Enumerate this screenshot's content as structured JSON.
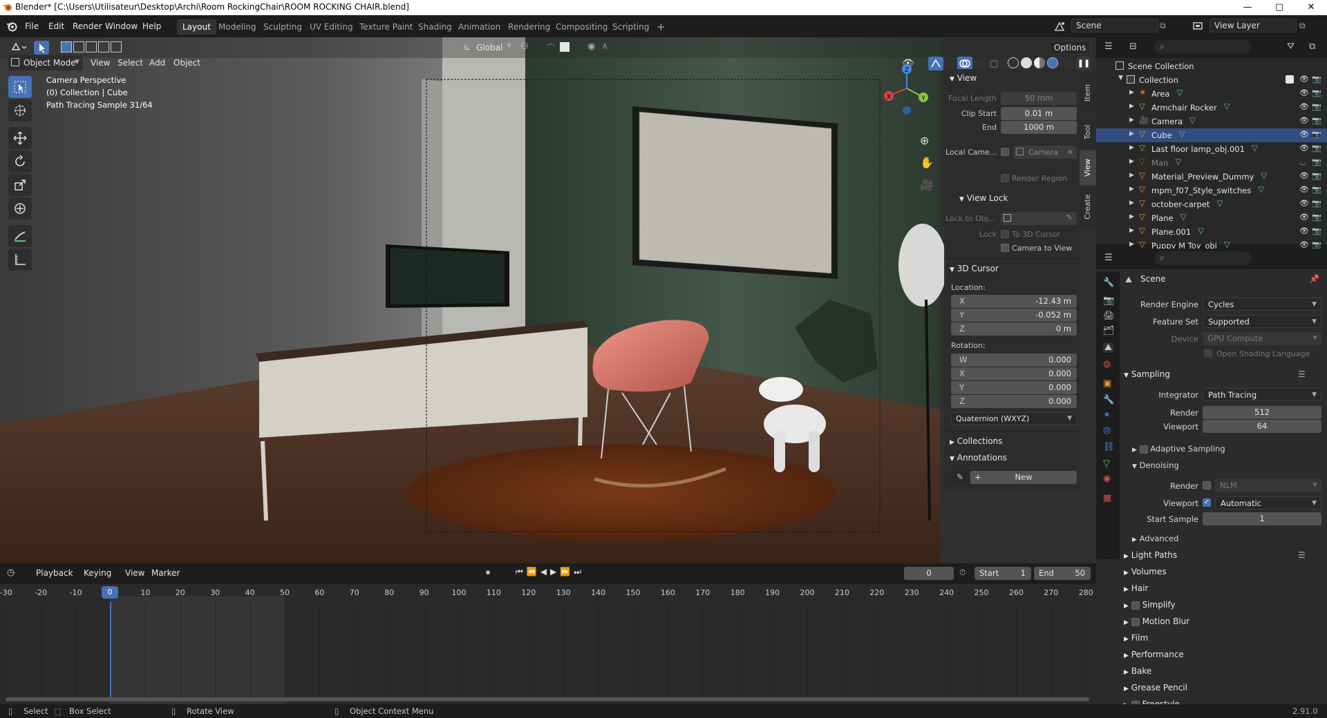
{
  "titlebar": {
    "title": "Blender* [C:\\Users\\Utilisateur\\Desktop\\Archi\\Room RockingChair\\ROOM ROCKING CHAIR.blend]",
    "minimize": "—",
    "maximize": "▢",
    "close": "✕"
  },
  "menubar": {
    "items": [
      "File",
      "Edit",
      "Render",
      "Window",
      "Help"
    ]
  },
  "workspaces": {
    "tabs": [
      "Layout",
      "Modeling",
      "Sculpting",
      "UV Editing",
      "Texture Paint",
      "Shading",
      "Animation",
      "Rendering",
      "Compositing",
      "Scripting"
    ],
    "active": "Layout",
    "add": "+"
  },
  "scene_selector": {
    "label": "Scene"
  },
  "viewlayer_selector": {
    "label": "View Layer"
  },
  "viewport_header": {
    "mode": "Object Mode",
    "menus": [
      "View",
      "Select",
      "Add",
      "Object"
    ],
    "transform_orientation": "Global",
    "options": "Options"
  },
  "viewport_overlay": {
    "line1": "Camera Perspective",
    "line2": "(0) Collection | Cube",
    "line3": "Path Tracing Sample 31/64"
  },
  "npanel": {
    "tabs": [
      "Item",
      "Tool",
      "View",
      "Create"
    ],
    "active_tab": "View",
    "view_section": "View",
    "focal_length_label": "Focal Length",
    "focal_length": "50 mm",
    "clip_start_label": "Clip Start",
    "clip_start": "0.01 m",
    "end_label": "End",
    "clip_end": "1000 m",
    "local_camera_label": "Local Came...",
    "local_camera_value": "Camera",
    "render_region": "Render Region",
    "view_lock_section": "View Lock",
    "lock_to_obj_label": "Lock to Obj...",
    "lock_label": "Lock",
    "to_3d_cursor": "To 3D Cursor",
    "camera_to_view": "Camera to View",
    "cursor_section": "3D Cursor",
    "location_label": "Location:",
    "loc": [
      {
        "k": "X",
        "v": "-12.43 m"
      },
      {
        "k": "Y",
        "v": "-0.052 m"
      },
      {
        "k": "Z",
        "v": "0 m"
      }
    ],
    "rotation_label": "Rotation:",
    "rot": [
      {
        "k": "W",
        "v": "0.000"
      },
      {
        "k": "X",
        "v": "0.000"
      },
      {
        "k": "Y",
        "v": "0.000"
      },
      {
        "k": "Z",
        "v": "0.000"
      }
    ],
    "rotation_mode": "Quaternion (WXYZ)",
    "collections_section": "Collections",
    "annotations_section": "Annotations",
    "new_button": "New"
  },
  "outliner": {
    "root": "Scene Collection",
    "collection": "Collection",
    "items": [
      {
        "name": "Area",
        "type": "light"
      },
      {
        "name": "Armchair Rocker",
        "type": "mesh"
      },
      {
        "name": "Camera",
        "type": "camera"
      },
      {
        "name": "Cube",
        "type": "mesh",
        "selected": true
      },
      {
        "name": "Last floor lamp_obj.001",
        "type": "mesh"
      },
      {
        "name": "Man",
        "type": "mesh",
        "hidden": true
      },
      {
        "name": "Material_Preview_Dummy",
        "type": "mesh"
      },
      {
        "name": "mpm_f07_Style_switches",
        "type": "mesh"
      },
      {
        "name": "october-carpet",
        "type": "mesh"
      },
      {
        "name": "Plane",
        "type": "mesh"
      },
      {
        "name": "Plane.001",
        "type": "mesh"
      },
      {
        "name": "Puppy M Toy_obj",
        "type": "mesh"
      }
    ]
  },
  "properties": {
    "context": "Scene",
    "render_engine_label": "Render Engine",
    "render_engine": "Cycles",
    "feature_set_label": "Feature Set",
    "feature_set": "Supported",
    "device_label": "Device",
    "device": "GPU Compute",
    "open_shading": "Open Shading Language",
    "sampling_section": "Sampling",
    "integrator_label": "Integrator",
    "integrator": "Path Tracing",
    "render_label": "Render",
    "render_samples": "512",
    "viewport_label": "Viewport",
    "viewport_samples": "64",
    "adaptive_sampling": "Adaptive Sampling",
    "denoising_section": "Denoising",
    "denoise_render_label": "Render",
    "denoise_render_value": "NLM",
    "denoise_viewport_label": "Viewport",
    "denoise_viewport_value": "Automatic",
    "start_sample_label": "Start Sample",
    "start_sample": "1",
    "advanced_section": "Advanced",
    "sections": [
      "Light Paths",
      "Volumes",
      "Hair",
      "Simplify",
      "Motion Blur",
      "Film",
      "Performance",
      "Bake",
      "Grease Pencil",
      "Freestyle"
    ]
  },
  "timeline": {
    "menus": [
      "Playback",
      "Keying",
      "View",
      "Marker"
    ],
    "current_frame": "0",
    "start_label": "Start",
    "start": "1",
    "end_label": "End",
    "end": "50",
    "ruler": [
      "-30",
      "-20",
      "-10",
      "0",
      "10",
      "20",
      "30",
      "40",
      "50",
      "60",
      "70",
      "80",
      "90",
      "100",
      "110",
      "120",
      "130",
      "140",
      "150",
      "160",
      "170",
      "180",
      "190",
      "200",
      "210",
      "220",
      "230",
      "240",
      "250",
      "260",
      "270",
      "280"
    ]
  },
  "statusbar": {
    "select": "Select",
    "box_select": "Box Select",
    "rotate_view": "Rotate View",
    "context_menu": "Object Context Menu",
    "version": "2.91.0"
  },
  "colors": {
    "accent": "#4772b3",
    "selected_row": "#334d80",
    "chair": "#e0786a",
    "mesh_icon": "#e59a3c",
    "vertex_icon": "#5fc27e"
  }
}
